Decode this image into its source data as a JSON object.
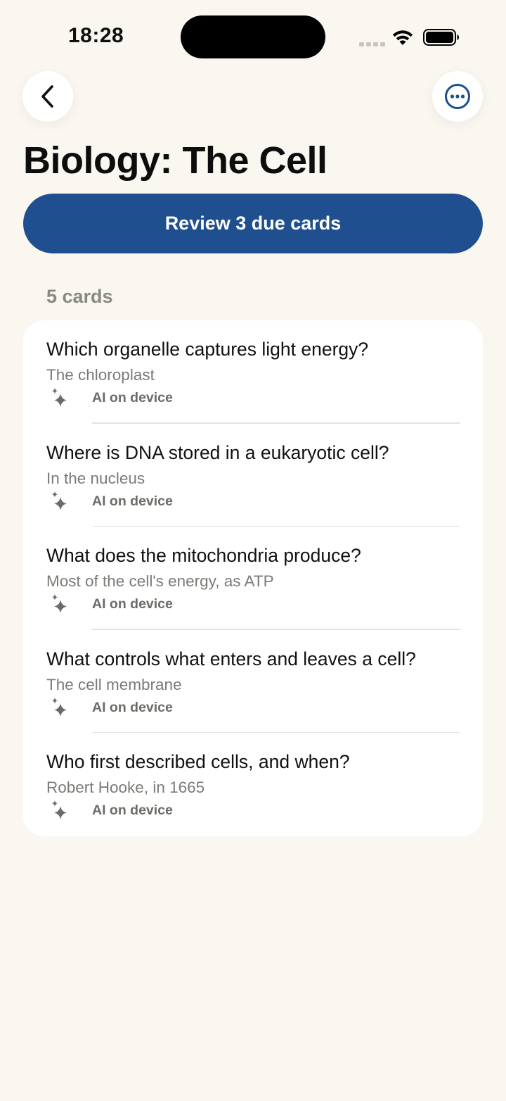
{
  "status_bar": {
    "time": "18:28"
  },
  "header": {
    "title": "Biology: The Cell"
  },
  "review_button": {
    "label": "Review 3 due cards"
  },
  "deck": {
    "card_count_label": "5 cards",
    "cards": [
      {
        "question": "Which organelle captures light energy?",
        "answer": "The chloroplast",
        "source": "AI on device"
      },
      {
        "question": "Where is DNA stored in a eukaryotic cell?",
        "answer": "In the nucleus",
        "source": "AI on device"
      },
      {
        "question": "What does the mitochondria produce?",
        "answer": "Most of the cell's energy, as ATP",
        "source": "AI on device"
      },
      {
        "question": "What controls what enters and leaves a cell?",
        "answer": "The cell membrane",
        "source": "AI on device"
      },
      {
        "question": "Who first described cells, and when?",
        "answer": "Robert Hooke, in 1665",
        "source": "AI on device"
      }
    ]
  },
  "colors": {
    "accent": "#1f4f8e",
    "background": "#faf7f0"
  },
  "icons": {
    "back": "chevron-left-icon",
    "more": "ellipsis-circle-icon",
    "ai": "sparkle-icon"
  }
}
